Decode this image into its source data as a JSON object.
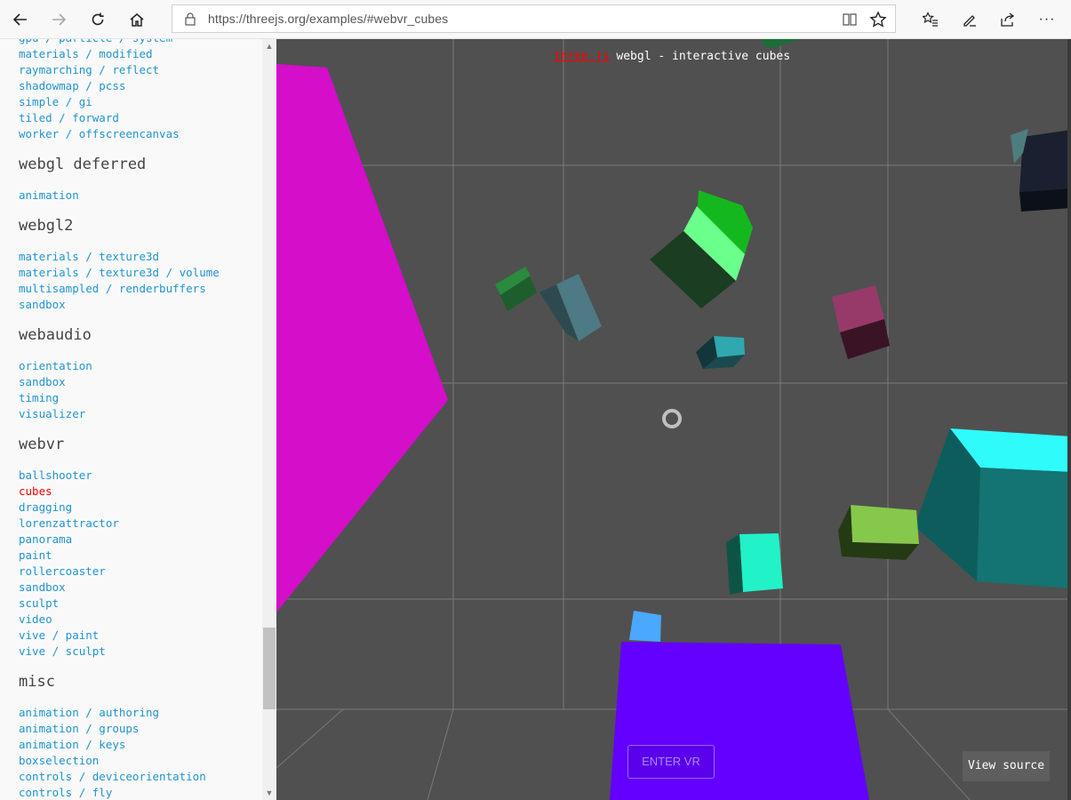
{
  "browser": {
    "url": "https://threejs.org/examples/#webvr_cubes",
    "nav": [
      "back-icon",
      "forward-icon",
      "refresh-icon",
      "home-icon"
    ],
    "right_icons": [
      "favorites-icon",
      "notes-icon",
      "share-icon",
      "more-icon"
    ],
    "more_label": "···"
  },
  "sidebar": {
    "groups": [
      {
        "title": "",
        "items": [
          "gpu / particle / system",
          "materials / modified",
          "raymarching / reflect",
          "shadowmap / pcss",
          "simple / gi",
          "tiled / forward",
          "worker / offscreencanvas"
        ]
      },
      {
        "title": "webgl deferred",
        "items": [
          "animation"
        ]
      },
      {
        "title": "webgl2",
        "items": [
          "materials / texture3d",
          "materials / texture3d / volume",
          "multisampled / renderbuffers",
          "sandbox"
        ]
      },
      {
        "title": "webaudio",
        "items": [
          "orientation",
          "sandbox",
          "timing",
          "visualizer"
        ]
      },
      {
        "title": "webvr",
        "items": [
          "ballshooter",
          "cubes",
          "dragging",
          "lorenzattractor",
          "panorama",
          "paint",
          "rollercoaster",
          "sandbox",
          "sculpt",
          "video",
          "vive / paint",
          "vive / sculpt"
        ]
      },
      {
        "title": "misc",
        "items": [
          "animation / authoring",
          "animation / groups",
          "animation / keys",
          "boxselection",
          "controls / deviceorientation",
          "controls / fly"
        ]
      }
    ],
    "selected": "cubes"
  },
  "viewport": {
    "info_link": "three.js",
    "info_text": " webgl - interactive cubes",
    "enter_vr": "ENTER VR",
    "view_source": "View source"
  },
  "colors": {
    "link": "#2194ce",
    "selected": "#ff0000",
    "background": "#505050"
  }
}
